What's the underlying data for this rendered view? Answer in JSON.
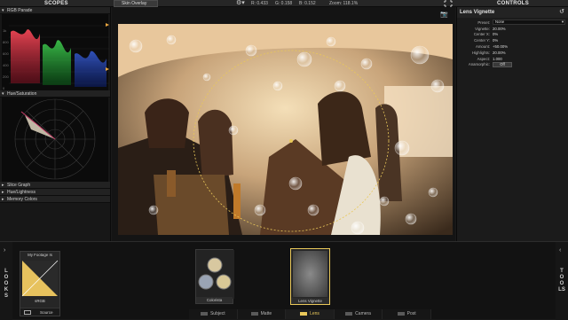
{
  "topbar": {
    "scopes_title": "SCOPES",
    "controls_title": "CONTROLS",
    "overlay_label": "Skin Overlay",
    "r_value": "R: 0.433",
    "g_value": "G: 0.158",
    "b_value": "B: 0.152",
    "zoom": "Zoom: 118.1%"
  },
  "scopes": {
    "rgb_parade": "RGB Parade",
    "hue_saturation": "Hue/Saturation",
    "parade_ticks": [
      "1k",
      "800",
      "600",
      "400",
      "200",
      "0"
    ],
    "collapsed": [
      {
        "label": "Slice Graph"
      },
      {
        "label": "Hue/Lightness"
      },
      {
        "label": "Memory Colors"
      }
    ]
  },
  "controls": {
    "title": "Lens Vignette",
    "preset_label": "Preset:",
    "preset_value": "None",
    "params": [
      {
        "label": "Vignette:",
        "value": "20.00%"
      },
      {
        "label": "Center X:",
        "value": "0%"
      },
      {
        "label": "Center Y:",
        "value": "0%"
      },
      {
        "label": "Amount:",
        "value": "+50.00%"
      },
      {
        "label": "Highlights:",
        "value": "20.00%"
      },
      {
        "label": "Aspect:",
        "value": "1.000"
      }
    ],
    "anamorphic_label": "Anamorphic:",
    "anamorphic_value": "Off"
  },
  "bottom": {
    "looks_label": "LOOKS",
    "tools_label": "TOOLS",
    "footage_card": {
      "title": "My Footage Is",
      "sub": "sRGB",
      "source": "Source"
    },
    "cards": [
      {
        "label": "Colorista"
      },
      {
        "label": "Lens Vignette"
      }
    ],
    "nav": [
      {
        "label": "Subject",
        "active": false
      },
      {
        "label": "Matte",
        "active": false
      },
      {
        "label": "Lens",
        "active": true
      },
      {
        "label": "Camera",
        "active": false
      },
      {
        "label": "Post",
        "active": false
      }
    ]
  },
  "colors": {
    "accent": "#e9c85a",
    "panel": "#1b1b1b",
    "background": "#121212"
  }
}
